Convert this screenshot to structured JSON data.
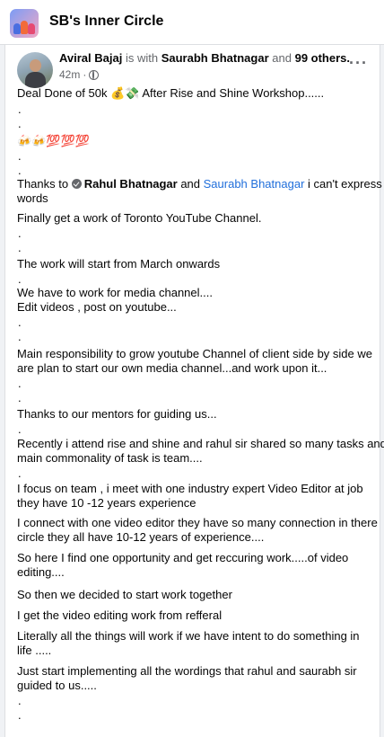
{
  "group": {
    "title": "SB's Inner Circle"
  },
  "post": {
    "author": "Aviral Bajaj",
    "with_text": "is with",
    "tagged": "Saurabh Bhatnagar",
    "and_text": "and",
    "others": "99 others.",
    "time": "42m",
    "dot_sep": "·",
    "more_icon": "···",
    "lines": {
      "l1": "Deal Done of 50k 💰💸  After Rise and Shine Workshop......",
      "l2": "🍻🍻💯💯💯",
      "l3a": "Thanks to ",
      "l3b": "Rahul Bhatnagar",
      "l3c": " and ",
      "l3d": "Saurabh Bhatnagar",
      "l3e": " i can't express",
      "l4": "words",
      "l5": "Finally get a work of Toronto YouTube Channel.",
      "l6": "The work will start from March onwards",
      "l7": "We have to work for media channel....",
      "l8": "Edit videos ,  post on youtube...",
      "l9": "Main responsibility to grow youtube Channel of client side by side we",
      "l10": "are plan to start  our own media channel...and work upon it...",
      "l11": "Thanks to our mentors for guiding us...",
      "l12": "Recently i attend rise and shine and rahul sir shared so many tasks and",
      "l13": "main commonality of task is team....",
      "l14": "I focus on team , i meet  with one industry expert Video Editor at job",
      "l15": "they have 10 -12 years experience",
      "l16": "I connect with one video editor they have so many connection in there",
      "l17": "circle they all have 10-12 years of experience....",
      "l18": "So here I find one opportunity and get reccuring work.....of video",
      "l19": "editing....",
      "l20": "So then we decided to start work together",
      "l21": "I get the video editing work from refferal",
      "l22": "Literally all the things will work if we have intent to do something in",
      "l23": "life .....",
      "l24": "Just start implementing all the wordings that rahul and saurabh sir",
      "l25": "guided to us.....",
      "dot": "."
    }
  }
}
